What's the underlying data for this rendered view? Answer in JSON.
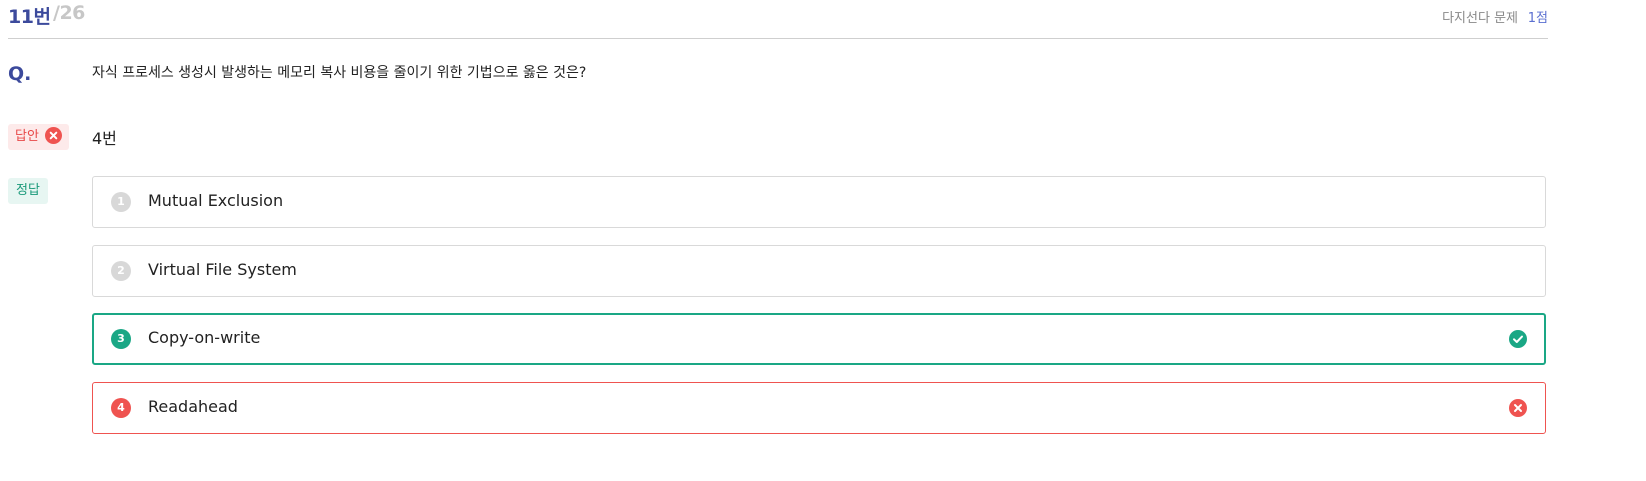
{
  "header": {
    "question_number": "11번",
    "total": "/26",
    "question_type": "다지선다 문제",
    "score": "1점"
  },
  "question": {
    "label": "Q.",
    "text": "자식 프로세스 생성시 발생하는 메모리 복사 비용을 줄이기 위한 기법으로 옳은 것은?"
  },
  "answer": {
    "badge_label": "답안",
    "value": "4번",
    "status_icon": "x-circle-icon",
    "badge_color": "#e84a4a"
  },
  "correct": {
    "badge_label": "정답",
    "badge_color": "#1a9a7a"
  },
  "options": [
    {
      "number": "1",
      "label": "Mutual Exclusion",
      "state": "neutral"
    },
    {
      "number": "2",
      "label": "Virtual File System",
      "state": "neutral"
    },
    {
      "number": "3",
      "label": "Copy-on-write",
      "state": "correct",
      "icon": "check-circle-icon"
    },
    {
      "number": "4",
      "label": "Readahead",
      "state": "wrong",
      "icon": "x-circle-icon"
    }
  ],
  "colors": {
    "accent": "#3c4a9c",
    "correct": "#1aa785",
    "wrong": "#ef5350",
    "muted": "#d8d8d8"
  }
}
